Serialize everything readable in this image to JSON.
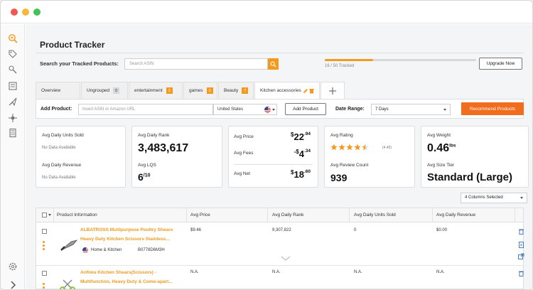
{
  "header": {
    "title": "Product Tracker"
  },
  "search": {
    "label": "Search your Tracked Products:",
    "placeholder": "Search ASIN"
  },
  "tracking": {
    "status": "16 / 50 Tracked",
    "progress_fraction": 0.32,
    "upgrade_label": "Upgrade Now"
  },
  "tabs": [
    {
      "label": "Overview",
      "badge": ""
    },
    {
      "label": "Ungrouped",
      "badge": "0"
    },
    {
      "label": "entertainment",
      "badge": "3"
    },
    {
      "label": "games",
      "badge": "3"
    },
    {
      "label": "Beauty",
      "badge": "7"
    },
    {
      "label": "Kitchen accessories",
      "badge": ""
    }
  ],
  "add_product": {
    "label": "Add Product:",
    "placeholder": "Insert ASIN or Amazon URL",
    "country": "United States",
    "button": "Add Product"
  },
  "date_range": {
    "label": "Date Range:",
    "value": "7 Days"
  },
  "recommend_button": "Recommend Products",
  "cards": {
    "units": {
      "title": "Avg Daily Units Sold",
      "value": "No Data Available",
      "revenue_title": "Avg Daily Revenue",
      "revenue_value": "No Data Available"
    },
    "rank": {
      "title": "Avg Daily Rank",
      "value": "3,483,617",
      "lqs_title": "Avg LQS",
      "lqs_value": "6",
      "lqs_suffix": "/10"
    },
    "price": {
      "price_title": "Avg Price",
      "price_currency": "$",
      "price_whole": "22",
      "price_cents": ".94",
      "fees_title": "Avg Fees",
      "fees_prefix": "-$",
      "fees_whole": "4",
      "fees_cents": ".34",
      "net_title": "Avg Net",
      "net_currency": "$",
      "net_whole": "18",
      "net_cents": ".60"
    },
    "rating": {
      "title": "Avg Rating",
      "stars": 4.5,
      "value": "(4.45)",
      "review_title": "Avg Review Count",
      "review_value": "939"
    },
    "weight": {
      "title": "Avg Weight",
      "value": "0.46",
      "unit": "lbs",
      "size_title": "Avg Size Tier",
      "size_value": "Standard (Large)"
    }
  },
  "columns_selected": "4 Columns Selected",
  "table": {
    "headers": [
      "Product Information",
      "Avg Price",
      "Avg Daily Rank",
      "Avg Daily Units Sold",
      "Avg Daily Revenue"
    ],
    "rows": [
      {
        "name_line1": "ALBATROSS Multipurpose Poultry Shears",
        "name_line2": "Heavy Duty Kitchen Scissors Stainless...",
        "category": "Home & Kitchen",
        "asin": "B0778D6M3H",
        "price": "$9.46",
        "rank": "9,307,822",
        "units": "0",
        "revenue": "$0.00"
      },
      {
        "name_line1": "Anfimu Kitchen Shears(Scissors) -",
        "name_line2": "Multifunction, Heavy Duty & Come-apart...",
        "category": "",
        "asin": "",
        "price": "N.A.",
        "rank": "N.A.",
        "units": "N.A.",
        "revenue": "N.A."
      }
    ]
  },
  "colors": {
    "accent": "#f39a1e",
    "recommend": "#f26c1e"
  }
}
